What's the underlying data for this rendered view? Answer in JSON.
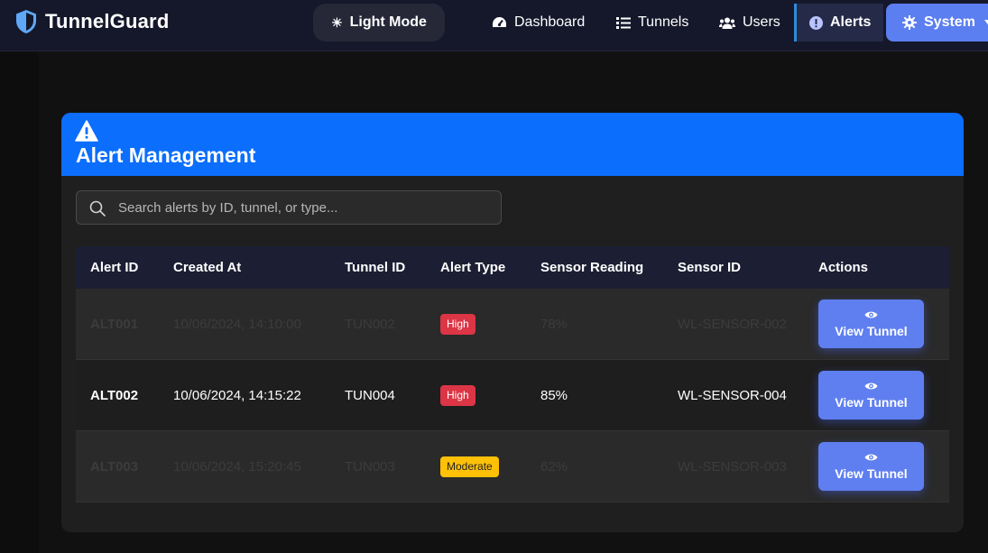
{
  "app": {
    "brand": "TunnelGuard",
    "theme_toggle": "Light Mode"
  },
  "nav": {
    "dashboard": "Dashboard",
    "tunnels": "Tunnels",
    "users": "Users",
    "alerts": "Alerts",
    "system": "System"
  },
  "page": {
    "title": "Alert Management"
  },
  "search": {
    "placeholder": "Search alerts by ID, tunnel, or type...",
    "value": ""
  },
  "table": {
    "headers": {
      "alert_id": "Alert ID",
      "created_at": "Created At",
      "tunnel_id": "Tunnel ID",
      "alert_type": "Alert Type",
      "sensor_reading": "Sensor Reading",
      "sensor_id": "Sensor ID",
      "actions": "Actions"
    },
    "rows": [
      {
        "alert_id": "ALT001",
        "created_at": "10/06/2024, 14:10:00",
        "tunnel_id": "TUN002",
        "alert_type": "High",
        "sensor_reading": "78%",
        "sensor_id": "WL-SENSOR-002",
        "action": "View Tunnel"
      },
      {
        "alert_id": "ALT002",
        "created_at": "10/06/2024, 14:15:22",
        "tunnel_id": "TUN004",
        "alert_type": "High",
        "sensor_reading": "85%",
        "sensor_id": "WL-SENSOR-004",
        "action": "View Tunnel"
      },
      {
        "alert_id": "ALT003",
        "created_at": "10/06/2024, 15:20:45",
        "tunnel_id": "TUN003",
        "alert_type": "Moderate",
        "sensor_reading": "62%",
        "sensor_id": "WL-SENSOR-003",
        "action": "View Tunnel"
      }
    ]
  },
  "colors": {
    "accent": "#0b6efd",
    "button": "#5f7ff0",
    "high": "#dc3545",
    "moderate": "#ffc107"
  }
}
